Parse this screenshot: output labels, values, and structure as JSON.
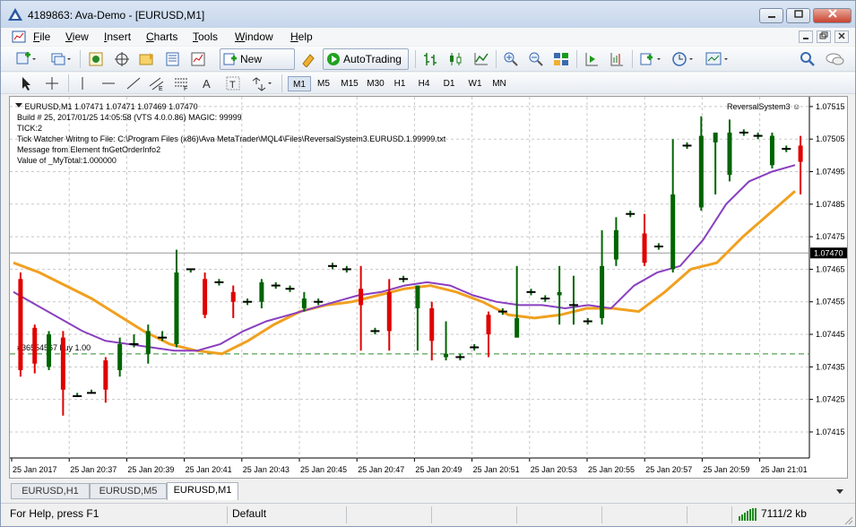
{
  "window": {
    "title": "4189863: Ava-Demo - [EURUSD,M1]",
    "minimize": "0",
    "maximize": "1",
    "close": "r"
  },
  "menu": {
    "items": [
      {
        "label": "File",
        "key": "F"
      },
      {
        "label": "View",
        "key": "V"
      },
      {
        "label": "Insert",
        "key": "I"
      },
      {
        "label": "Charts",
        "key": "C"
      },
      {
        "label": "Tools",
        "key": "T"
      },
      {
        "label": "Window",
        "key": "W"
      },
      {
        "label": "Help",
        "key": "H"
      }
    ]
  },
  "toolbar": {
    "new_order": "New Order",
    "autotrading": "AutoTrading"
  },
  "timeframes": [
    "M1",
    "M5",
    "M15",
    "M30",
    "H1",
    "H4",
    "D1",
    "W1",
    "MN"
  ],
  "active_timeframe": "M1",
  "chart": {
    "header": "EURUSD,M1  1.07471 1.07471 1.07469 1.07470",
    "info_lines": [
      "Build # 25, 2017/01/25 14:05:58  (VTS 4.0.0.86) MAGIC: 99999",
      "TICK:2",
      "Tick Watcher Writng to File: C:\\Program Files (x86)\\Ava MetaTrader\\MQL4\\Files\\ReversalSystem3.EURUSD.1.99999.txt",
      "Message from Element fnGetOrderInfo2",
      "Value of _MyTotal:1.000000"
    ],
    "ea_name": "ReversalSystem3 ☺",
    "order_label": "#36554567 buy 1.00",
    "current_price": "1.07470",
    "colors": {
      "bull": "#006400",
      "bear": "#e00000",
      "ma_fast": "#8a3fbf",
      "ma_slow": "#f0a020",
      "order_line": "#2e8b2e",
      "grid": "#c8c8c8"
    }
  },
  "chart_data": {
    "type": "candlestick",
    "symbol": "EURUSD",
    "timeframe": "M1",
    "y_ticks": [
      "1.07515",
      "1.07505",
      "1.07495",
      "1.07485",
      "1.07475",
      "1.07465",
      "1.07455",
      "1.07445",
      "1.07435",
      "1.07425",
      "1.07415"
    ],
    "ylim": [
      1.07407,
      1.07518
    ],
    "x_ticks": [
      "25 Jan 2017",
      "25 Jan 20:37",
      "25 Jan 20:39",
      "25 Jan 20:41",
      "25 Jan 20:43",
      "25 Jan 20:45",
      "25 Jan 20:47",
      "25 Jan 20:49",
      "25 Jan 20:51",
      "25 Jan 20:53",
      "25 Jan 20:55",
      "25 Jan 20:57",
      "25 Jan 20:59",
      "25 Jan 21:01"
    ],
    "order_price": 1.07439,
    "current_price": 1.0747,
    "candles": [
      {
        "o": 1.07462,
        "h": 1.07464,
        "l": 1.07432,
        "c": 1.07434
      },
      {
        "o": 1.07447,
        "h": 1.07448,
        "l": 1.07433,
        "c": 1.07436
      },
      {
        "o": 1.07435,
        "h": 1.07446,
        "l": 1.07434,
        "c": 1.07445
      },
      {
        "o": 1.07444,
        "h": 1.07446,
        "l": 1.0742,
        "c": 1.07428
      },
      {
        "o": 1.07426,
        "h": 1.07427,
        "l": 1.07426,
        "c": 1.07426
      },
      {
        "o": 1.07427,
        "h": 1.07428,
        "l": 1.07427,
        "c": 1.07427
      },
      {
        "o": 1.07437,
        "h": 1.07438,
        "l": 1.07424,
        "c": 1.07428
      },
      {
        "o": 1.07434,
        "h": 1.07444,
        "l": 1.07432,
        "c": 1.07442
      },
      {
        "o": 1.07442,
        "h": 1.07445,
        "l": 1.07441,
        "c": 1.07442
      },
      {
        "o": 1.07439,
        "h": 1.07448,
        "l": 1.07436,
        "c": 1.07446
      },
      {
        "o": 1.07444,
        "h": 1.07446,
        "l": 1.07443,
        "c": 1.07444
      },
      {
        "o": 1.07442,
        "h": 1.07471,
        "l": 1.07441,
        "c": 1.07464
      },
      {
        "o": 1.07465,
        "h": 1.07465,
        "l": 1.07464,
        "c": 1.07465
      },
      {
        "o": 1.07462,
        "h": 1.07464,
        "l": 1.0745,
        "c": 1.07451
      },
      {
        "o": 1.07461,
        "h": 1.07462,
        "l": 1.0746,
        "c": 1.07461
      },
      {
        "o": 1.07458,
        "h": 1.0746,
        "l": 1.0745,
        "c": 1.07455
      },
      {
        "o": 1.07455,
        "h": 1.07456,
        "l": 1.07454,
        "c": 1.07455
      },
      {
        "o": 1.07455,
        "h": 1.07462,
        "l": 1.07453,
        "c": 1.07461
      },
      {
        "o": 1.0746,
        "h": 1.07461,
        "l": 1.07459,
        "c": 1.0746
      },
      {
        "o": 1.07459,
        "h": 1.0746,
        "l": 1.07458,
        "c": 1.07459
      },
      {
        "o": 1.07453,
        "h": 1.07458,
        "l": 1.07452,
        "c": 1.07456
      },
      {
        "o": 1.07455,
        "h": 1.07456,
        "l": 1.07454,
        "c": 1.07455
      },
      {
        "o": 1.07466,
        "h": 1.07467,
        "l": 1.07465,
        "c": 1.07466
      },
      {
        "o": 1.07465,
        "h": 1.07466,
        "l": 1.07464,
        "c": 1.07465
      },
      {
        "o": 1.07459,
        "h": 1.07466,
        "l": 1.0744,
        "c": 1.07454
      },
      {
        "o": 1.07446,
        "h": 1.07447,
        "l": 1.07445,
        "c": 1.07446
      },
      {
        "o": 1.07458,
        "h": 1.07462,
        "l": 1.0744,
        "c": 1.07446
      },
      {
        "o": 1.07462,
        "h": 1.07463,
        "l": 1.07461,
        "c": 1.07462
      },
      {
        "o": 1.07453,
        "h": 1.0746,
        "l": 1.0744,
        "c": 1.0746
      },
      {
        "o": 1.07453,
        "h": 1.07455,
        "l": 1.07437,
        "c": 1.07443
      },
      {
        "o": 1.07438,
        "h": 1.07449,
        "l": 1.07437,
        "c": 1.07439
      },
      {
        "o": 1.07438,
        "h": 1.07439,
        "l": 1.07437,
        "c": 1.07438
      },
      {
        "o": 1.07441,
        "h": 1.07442,
        "l": 1.0744,
        "c": 1.07441
      },
      {
        "o": 1.07451,
        "h": 1.07452,
        "l": 1.07438,
        "c": 1.07445
      },
      {
        "o": 1.07452,
        "h": 1.07453,
        "l": 1.07451,
        "c": 1.07452
      },
      {
        "o": 1.07444,
        "h": 1.07466,
        "l": 1.07444,
        "c": 1.0745
      },
      {
        "o": 1.07458,
        "h": 1.07459,
        "l": 1.07457,
        "c": 1.07458
      },
      {
        "o": 1.07456,
        "h": 1.07457,
        "l": 1.07455,
        "c": 1.07456
      },
      {
        "o": 1.07457,
        "h": 1.07466,
        "l": 1.07448,
        "c": 1.07458
      },
      {
        "o": 1.07454,
        "h": 1.07463,
        "l": 1.07448,
        "c": 1.07454
      },
      {
        "o": 1.07449,
        "h": 1.0745,
        "l": 1.07448,
        "c": 1.07449
      },
      {
        "o": 1.0745,
        "h": 1.07477,
        "l": 1.07448,
        "c": 1.07466
      },
      {
        "o": 1.07468,
        "h": 1.07481,
        "l": 1.07466,
        "c": 1.07477
      },
      {
        "o": 1.07482,
        "h": 1.07483,
        "l": 1.07481,
        "c": 1.07482
      },
      {
        "o": 1.07476,
        "h": 1.07482,
        "l": 1.07466,
        "c": 1.07467
      },
      {
        "o": 1.07472,
        "h": 1.07473,
        "l": 1.07471,
        "c": 1.07472
      },
      {
        "o": 1.07465,
        "h": 1.07505,
        "l": 1.07464,
        "c": 1.07488
      },
      {
        "o": 1.07503,
        "h": 1.07504,
        "l": 1.07502,
        "c": 1.07503
      },
      {
        "o": 1.07484,
        "h": 1.07512,
        "l": 1.07483,
        "c": 1.07506
      },
      {
        "o": 1.07504,
        "h": 1.07505,
        "l": 1.07488,
        "c": 1.07507
      },
      {
        "o": 1.07494,
        "h": 1.07511,
        "l": 1.07492,
        "c": 1.07507
      },
      {
        "o": 1.07507,
        "h": 1.07508,
        "l": 1.07506,
        "c": 1.07507
      },
      {
        "o": 1.07506,
        "h": 1.07507,
        "l": 1.07505,
        "c": 1.07506
      },
      {
        "o": 1.07497,
        "h": 1.07507,
        "l": 1.07496,
        "c": 1.07506
      },
      {
        "o": 1.07502,
        "h": 1.07503,
        "l": 1.07501,
        "c": 1.07502
      },
      {
        "o": 1.07503,
        "h": 1.07506,
        "l": 1.07488,
        "c": 1.07498
      }
    ],
    "ma_fast": [
      1.07458,
      1.07454,
      1.0745,
      1.07446,
      1.07443,
      1.07442,
      1.07441,
      1.0744,
      1.0744,
      1.07442,
      1.07446,
      1.07449,
      1.07451,
      1.07453,
      1.07455,
      1.07457,
      1.07458,
      1.0746,
      1.07461,
      1.0746,
      1.07457,
      1.07455,
      1.07454,
      1.07454,
      1.07453,
      1.07454,
      1.07453,
      1.0746,
      1.07464,
      1.07466,
      1.07474,
      1.07485,
      1.07492,
      1.07495,
      1.07497
    ],
    "ma_slow": [
      1.07467,
      1.07464,
      1.0746,
      1.07456,
      1.07451,
      1.07446,
      1.07442,
      1.0744,
      1.07439,
      1.07443,
      1.07448,
      1.07452,
      1.07454,
      1.07455,
      1.07457,
      1.07459,
      1.0746,
      1.07458,
      1.07455,
      1.07451,
      1.0745,
      1.07451,
      1.07453,
      1.07453,
      1.07452,
      1.07458,
      1.07465,
      1.07467,
      1.07475,
      1.07482,
      1.07489
    ]
  },
  "tabs": [
    "EURUSD,H1",
    "EURUSD,M5",
    "EURUSD,M1"
  ],
  "active_tab": "EURUSD,M1",
  "status": {
    "help": "For Help, press F1",
    "profile": "Default",
    "traffic": "7111/2 kb"
  }
}
